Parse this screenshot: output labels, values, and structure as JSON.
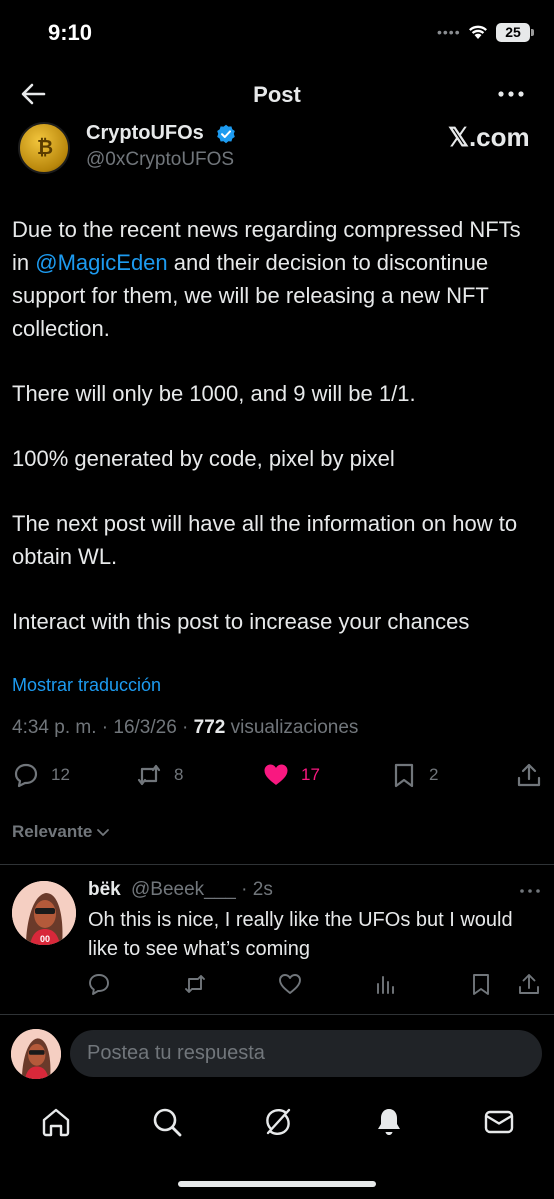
{
  "status_bar": {
    "time": "9:10",
    "battery": "25"
  },
  "header": {
    "title": "Post"
  },
  "post": {
    "author_name": "CryptoUFOs",
    "author_handle": "@0xCryptoUFOS",
    "source_logo": "𝕏.com",
    "paragraph1_pre": "Due to the recent news regarding compressed NFTs in ",
    "paragraph1_mention": "@MagicEden",
    "paragraph1_post": " and their decision to discontinue support for them, we will be releasing a new NFT collection.",
    "paragraph2": "There will only be 1000, and 9 will be 1/1.",
    "paragraph3": "100% generated by code, pixel by pixel",
    "paragraph4": "The next post will have all the information on how to obtain WL.",
    "paragraph5": "Interact with this post to increase your chances",
    "translate_label": "Mostrar traducción",
    "timestamp": "4:34 p. m. · 16/3/26 · ",
    "views_count": "772",
    "views_label": " visualizaciones",
    "stats": {
      "replies": "12",
      "reposts": "8",
      "likes": "17",
      "bookmarks": "2"
    }
  },
  "sort": {
    "label": "Relevante"
  },
  "reply": {
    "name": "bëk",
    "handle": "@Beeek___ · 2s",
    "text": "Oh this is nice, I really like the UFOs but I would like to see what’s coming"
  },
  "compose": {
    "placeholder": "Postea tu respuesta"
  },
  "colors": {
    "accent": "#1d9bf0",
    "like": "#f91880",
    "muted": "#71767b",
    "background": "#000000"
  },
  "icons": [
    "back-arrow-icon",
    "more-icon",
    "verified-icon",
    "reply-icon",
    "repost-icon",
    "heart-icon",
    "bookmark-icon",
    "share-icon",
    "views-icon",
    "home-icon",
    "search-icon",
    "grok-icon",
    "bell-icon",
    "mail-icon",
    "wifi-icon"
  ]
}
